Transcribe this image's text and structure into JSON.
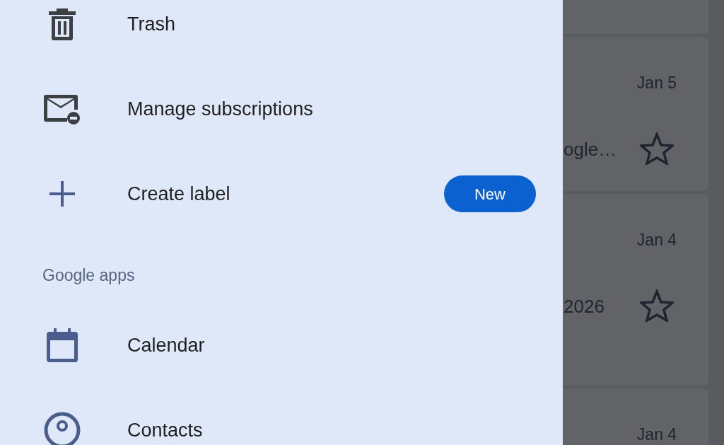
{
  "drawer": {
    "items": [
      {
        "kind": "item",
        "label": "Trash"
      },
      {
        "kind": "item",
        "label": "Manage subscriptions"
      },
      {
        "kind": "item",
        "label": "Create label",
        "badge": "New"
      },
      {
        "kind": "section",
        "label": "Google apps"
      },
      {
        "kind": "item",
        "label": "Calendar"
      },
      {
        "kind": "item",
        "label": "Contacts"
      }
    ]
  },
  "inbox": {
    "messages": [
      {
        "date": "Jan 5",
        "snippet": "ogle…",
        "starred": false
      },
      {
        "date": "Jan 4",
        "snippet": "2026",
        "starred": false
      },
      {
        "date": "Jan 4"
      }
    ]
  }
}
